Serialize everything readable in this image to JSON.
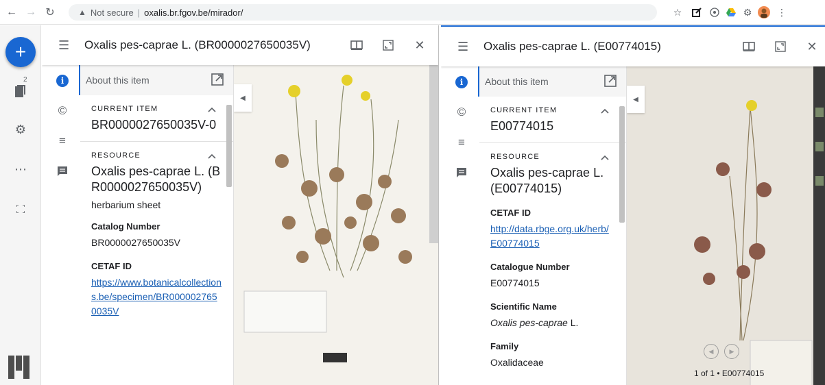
{
  "browser": {
    "security_label": "Not secure",
    "url": "oxalis.br.fgov.be/mirador/"
  },
  "rail": {
    "add_symbol": "+",
    "windows_badge": "2"
  },
  "window1": {
    "title": "Oxalis pes-caprae L. (BR0000027650035V)",
    "about_label": "About this item",
    "current_item": {
      "label": "CURRENT ITEM",
      "value": "BR0000027650035V-0"
    },
    "resource": {
      "label": "RESOURCE",
      "value": "Oxalis pes-caprae L. (BR0000027650035V)",
      "subtitle": "herbarium sheet",
      "catalog_label": "Catalog Number",
      "catalog_value": "BR0000027650035V",
      "cetaf_label": "CETAF ID",
      "cetaf_link": "https://www.botanicalcollections.be/specimen/BR0000027650035V"
    }
  },
  "window2": {
    "title": "Oxalis pes-caprae L. (E00774015)",
    "about_label": "About this item",
    "current_item": {
      "label": "CURRENT ITEM",
      "value": "E00774015"
    },
    "resource": {
      "label": "RESOURCE",
      "value": "Oxalis pes-caprae L. (E00774015)",
      "cetaf_label": "CETAF ID",
      "cetaf_link": "http://data.rbge.org.uk/herb/E00774015",
      "catalogue_label": "Catalogue Number",
      "catalogue_value": "E00774015",
      "scientific_label": "Scientific Name",
      "scientific_italic": "Oxalis pes-caprae",
      "scientific_author": " L.",
      "family_label": "Family",
      "family_value": "Oxalidaceae"
    },
    "page_info": "1 of 1 • E00774015"
  },
  "colors": {
    "accent": "#1967d2",
    "link": "#1a5fb4",
    "panel_header": "#f5f5f5"
  }
}
